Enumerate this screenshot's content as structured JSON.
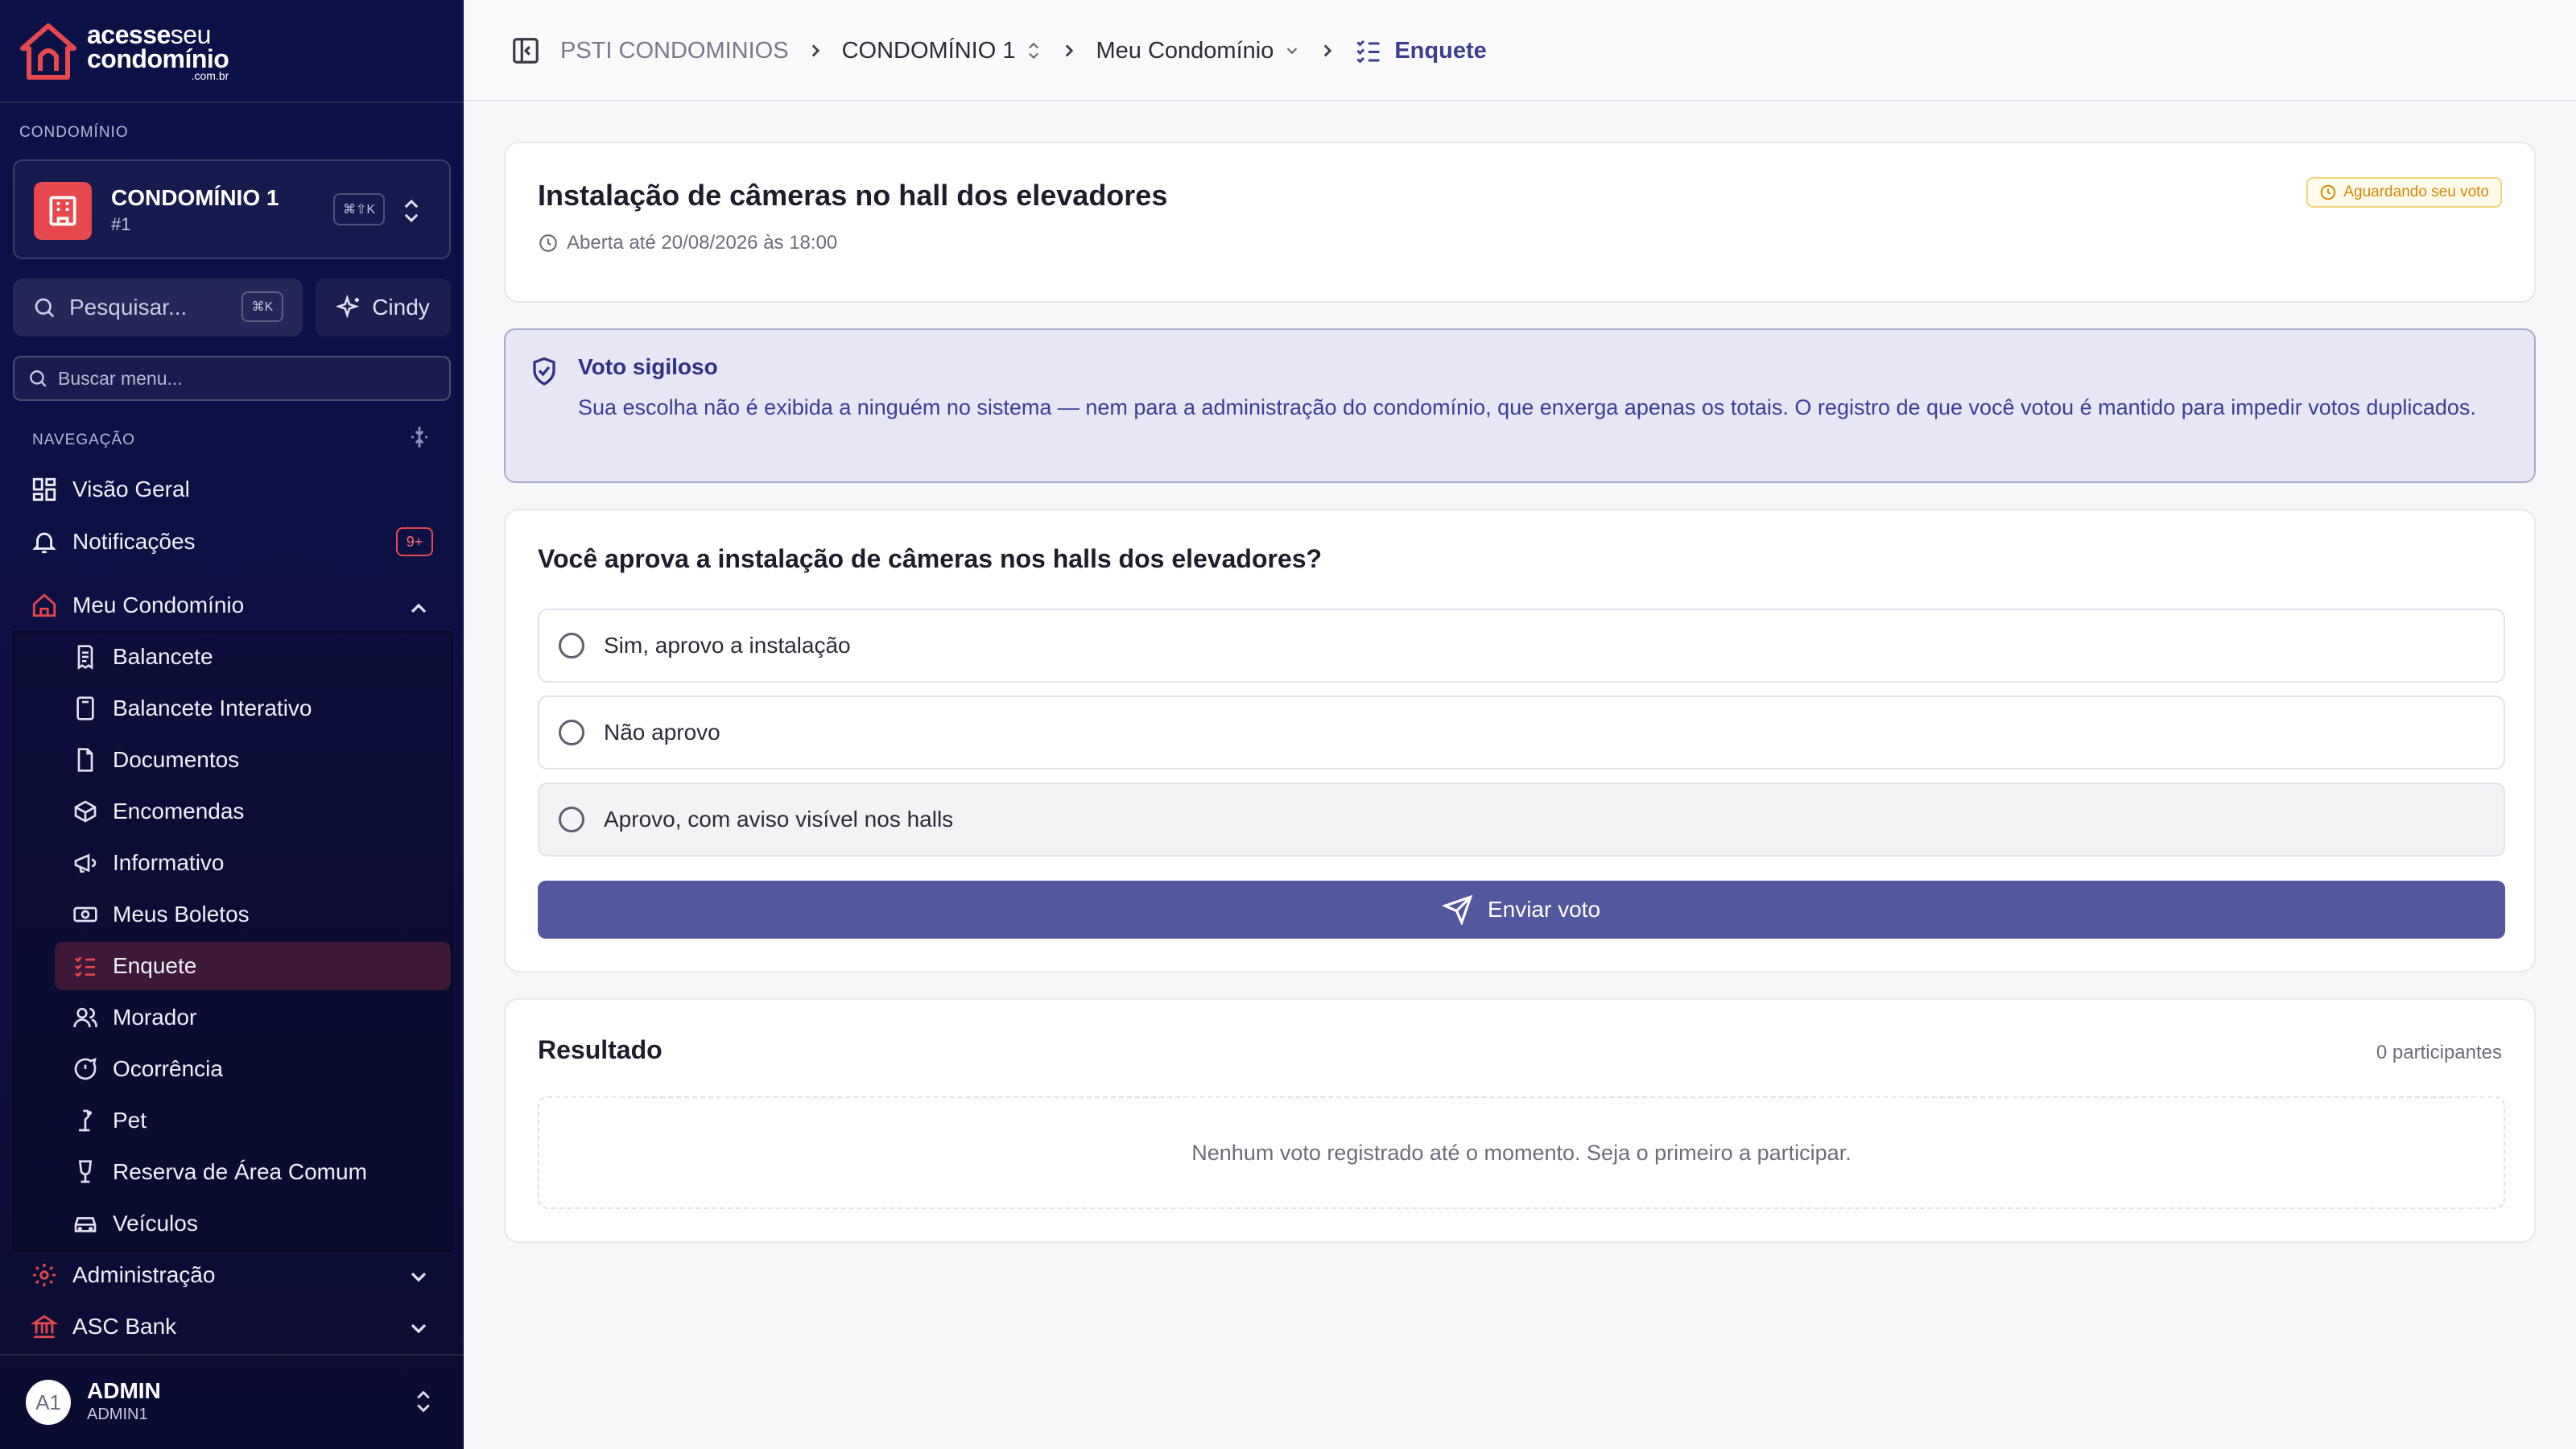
{
  "brand": {
    "line1_a": "acesse",
    "line1_b": "seu",
    "line2": "condomínio",
    "line3": ".com.br",
    "accent": "#e5484d"
  },
  "sidebar": {
    "condo_section_label": "CONDOMÍNIO",
    "condo_name": "CONDOMÍNIO 1",
    "condo_number": "#1",
    "condo_shortcut": "⌘⇧K",
    "search_label": "Pesquisar...",
    "search_shortcut": "⌘K",
    "assistant_label": "Cindy",
    "menu_search_placeholder": "Buscar menu...",
    "nav_section_label": "NAVEGAÇÃO",
    "top_items": [
      {
        "label": "Visão Geral",
        "icon": "grid-icon"
      },
      {
        "label": "Notificações",
        "icon": "bell-icon",
        "badge": "9+"
      }
    ],
    "group_label": "Meu Condomínio",
    "sub_items": [
      {
        "label": "Balancete",
        "icon": "receipt-icon"
      },
      {
        "label": "Balancete Interativo",
        "icon": "calculator-icon"
      },
      {
        "label": "Documentos",
        "icon": "file-icon"
      },
      {
        "label": "Encomendas",
        "icon": "boxes-icon"
      },
      {
        "label": "Informativo",
        "icon": "megaphone-icon"
      },
      {
        "label": "Meus Boletos",
        "icon": "banknote-icon"
      },
      {
        "label": "Enquete",
        "icon": "list-checks-icon",
        "active": true
      },
      {
        "label": "Morador",
        "icon": "users-icon"
      },
      {
        "label": "Ocorrência",
        "icon": "message-icon"
      },
      {
        "label": "Pet",
        "icon": "paw-icon"
      },
      {
        "label": "Reserva de Área Comum",
        "icon": "wine-icon"
      },
      {
        "label": "Veículos",
        "icon": "car-icon"
      }
    ],
    "bottom_groups": [
      {
        "label": "Administração",
        "icon": "gear-icon"
      },
      {
        "label": "ASC Bank",
        "icon": "bank-icon"
      }
    ],
    "user": {
      "initials": "A1",
      "name": "ADMIN",
      "login": "ADMIN1"
    }
  },
  "breadcrumb": {
    "items": [
      "PSTI CONDOMINIOS",
      "CONDOMÍNIO 1",
      "Meu Condomínio",
      "Enquete"
    ]
  },
  "poll": {
    "title": "Instalação de câmeras no hall dos elevadores",
    "deadline": "Aberta até 20/08/2026 às 18:00",
    "status": "Aguardando seu voto",
    "status_color": "#d08a05"
  },
  "notice": {
    "title": "Voto sigiloso",
    "body": "Sua escolha não é exibida a ninguém no sistema — nem para a administração do condomínio, que enxerga apenas os totais. O registro de que você votou é mantido para impedir votos duplicados."
  },
  "question": {
    "text": "Você aprova a instalação de câmeras nos halls dos elevadores?",
    "options": [
      "Sim, aprovo a instalação",
      "Não aprovo",
      "Aprovo, com aviso visível nos halls"
    ],
    "submit_label": "Enviar voto",
    "submit_color": "#53579e"
  },
  "result": {
    "title": "Resultado",
    "participants": "0 participantes",
    "empty_message": "Nenhum voto registrado até o momento. Seja o primeiro a participar."
  }
}
